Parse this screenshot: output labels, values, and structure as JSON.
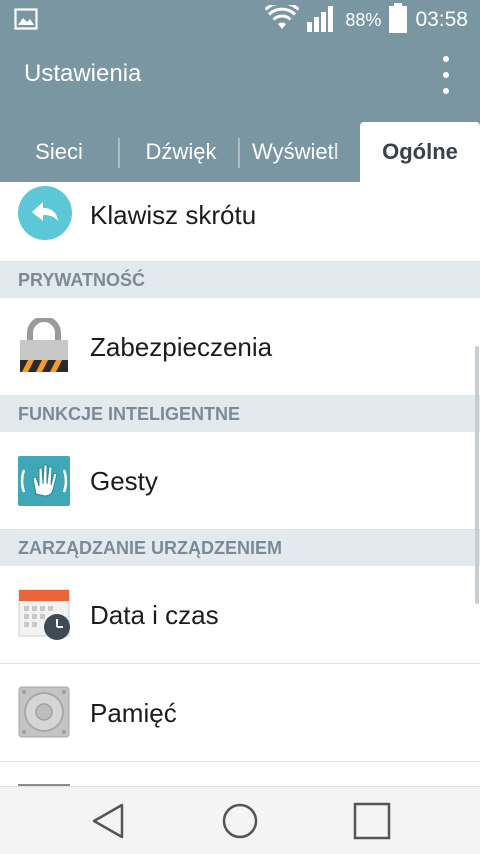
{
  "status_bar": {
    "battery_percent": "88%",
    "time": "03:58",
    "icons": [
      "gallery-icon",
      "wifi-icon",
      "signal-icon",
      "battery-icon"
    ]
  },
  "app_bar": {
    "title": "Ustawienia",
    "menu_icon": "overflow-menu-icon"
  },
  "tabs": [
    {
      "label": "Sieci",
      "active": false
    },
    {
      "label": "Dźwięk",
      "active": false
    },
    {
      "label": "Wyświetl",
      "active": false
    },
    {
      "label": "Ogólne",
      "active": true
    }
  ],
  "list": {
    "items": [
      {
        "type": "item",
        "label": "Klawisz skrótu",
        "icon": "shortcut-key-icon"
      },
      {
        "type": "section",
        "label": "PRYWATNOŚĆ"
      },
      {
        "type": "item",
        "label": "Zabezpieczenia",
        "icon": "lock-icon"
      },
      {
        "type": "section",
        "label": "FUNKCJE INTELIGENTNE"
      },
      {
        "type": "item",
        "label": "Gesty",
        "icon": "gesture-hand-icon"
      },
      {
        "type": "section",
        "label": "ZARZĄDZANIE URZĄDZENIEM"
      },
      {
        "type": "item",
        "label": "Data i czas",
        "icon": "calendar-clock-icon"
      },
      {
        "type": "item",
        "label": "Pamięć",
        "icon": "storage-icon"
      }
    ]
  },
  "colors": {
    "header": "#7b96a3",
    "section_bg": "#e3eaee",
    "section_text": "#7b8b96",
    "shortcut_icon": "#5cc7d6",
    "calendar_accent": "#e8653a"
  },
  "nav_bar": {
    "buttons": [
      "back-icon",
      "home-icon",
      "recents-icon"
    ]
  }
}
